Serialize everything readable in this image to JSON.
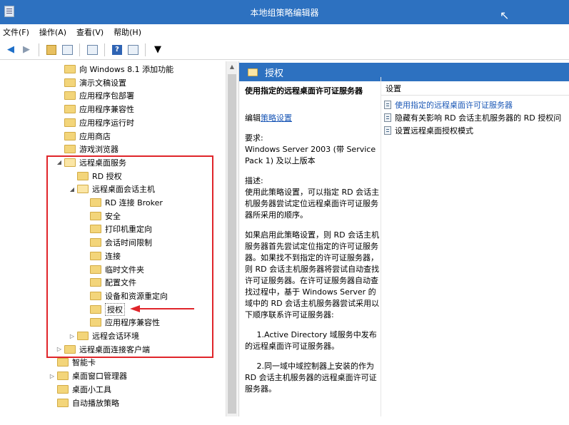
{
  "window": {
    "title": "本地组策略编辑器"
  },
  "menu": [
    "文件(F)",
    "操作(A)",
    "查看(V)",
    "帮助(H)"
  ],
  "toolbar": {
    "icons": [
      "back-arrow-icon",
      "forward-arrow-icon",
      "up-folder-icon",
      "show-hide-tree-icon",
      "export-list-icon",
      "help-icon",
      "properties-icon",
      "filter-icon"
    ]
  },
  "tree": {
    "items": [
      {
        "label": "向 Windows 8.1 添加功能",
        "level": 0,
        "arrow": ""
      },
      {
        "label": "演示文稿设置",
        "level": 0,
        "arrow": ""
      },
      {
        "label": "应用程序包部署",
        "level": 0,
        "arrow": ""
      },
      {
        "label": "应用程序兼容性",
        "level": 0,
        "arrow": ""
      },
      {
        "label": "应用程序运行时",
        "level": 0,
        "arrow": ""
      },
      {
        "label": "应用商店",
        "level": 0,
        "arrow": ""
      },
      {
        "label": "游戏浏览器",
        "level": 0,
        "arrow": ""
      },
      {
        "label": "远程桌面服务",
        "level": 0,
        "arrow": "◢"
      },
      {
        "label": "RD 授权",
        "level": 1,
        "arrow": ""
      },
      {
        "label": "远程桌面会话主机",
        "level": 1,
        "arrow": "◢"
      },
      {
        "label": "RD 连接 Broker",
        "level": 2,
        "arrow": ""
      },
      {
        "label": "安全",
        "level": 2,
        "arrow": ""
      },
      {
        "label": "打印机重定向",
        "level": 2,
        "arrow": ""
      },
      {
        "label": "会话时间限制",
        "level": 2,
        "arrow": ""
      },
      {
        "label": "连接",
        "level": 2,
        "arrow": ""
      },
      {
        "label": "临时文件夹",
        "level": 2,
        "arrow": ""
      },
      {
        "label": "配置文件",
        "level": 2,
        "arrow": ""
      },
      {
        "label": "设备和资源重定向",
        "level": 2,
        "arrow": ""
      },
      {
        "label": "授权",
        "level": 2,
        "arrow": "",
        "selected": true
      },
      {
        "label": "应用程序兼容性",
        "level": 2,
        "arrow": ""
      },
      {
        "label": "远程会话环境",
        "level": 1,
        "arrow": "▷"
      },
      {
        "label": "远程桌面连接客户端",
        "level": 0,
        "arrow": "▷"
      },
      {
        "label": "智能卡",
        "level": -1,
        "arrow": ""
      },
      {
        "label": "桌面窗口管理器",
        "level": -1,
        "arrow": "▷"
      },
      {
        "label": "桌面小工具",
        "level": -1,
        "arrow": ""
      },
      {
        "label": "自动播放策略",
        "level": -1,
        "arrow": ""
      }
    ]
  },
  "detail": {
    "header": "授权",
    "policy_title": "使用指定的远程桌面许可证服务器",
    "edit_prefix": "编辑",
    "edit_link": "策略设置",
    "requirements_label": "要求:",
    "requirements": "Windows Server 2003 (带 Service Pack 1) 及以上版本",
    "description_label": "描述:",
    "paragraphs": [
      "使用此策略设置，可以指定 RD 会话主机服务器尝试定位远程桌面许可证服务器所采用的顺序。",
      "如果启用此策略设置，则 RD 会话主机服务器首先尝试定位指定的许可证服务器。如果找不到指定的许可证服务器，则 RD 会话主机服务器将尝试自动查找许可证服务器。在许可证服务器自动查找过程中，基于 Windows Server 的域中的 RD 会话主机服务器尝试采用以下顺序联系许可证服务器:",
      "1.Active Directory 域服务中发布的远程桌面许可证服务器。",
      "2.同一域中域控制器上安装的作为 RD 会话主机服务器的远程桌面许可证服务器。"
    ]
  },
  "list": {
    "column": "设置",
    "rows": [
      {
        "label": "使用指定的远程桌面许可证服务器",
        "selected": true
      },
      {
        "label": "隐藏有关影响 RD 会话主机服务器的 RD 授权问",
        "selected": false
      },
      {
        "label": "设置远程桌面授权模式",
        "selected": false
      }
    ]
  }
}
